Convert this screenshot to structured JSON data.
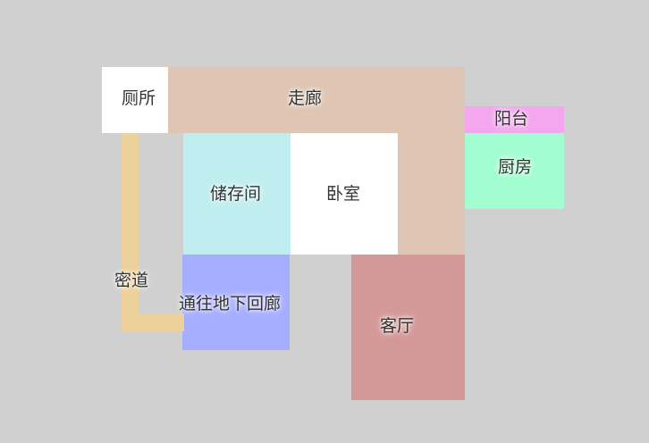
{
  "floorplan": {
    "rooms": {
      "toilet": {
        "label": "厕所",
        "color": "#ffffff"
      },
      "corridor": {
        "label": "走廊",
        "color": "#dfc5b3"
      },
      "balcony": {
        "label": "阳台",
        "color": "#f4a6ee"
      },
      "kitchen": {
        "label": "厨房",
        "color": "#a2fed0"
      },
      "storage": {
        "label": "储存间",
        "color": "#c0eef0"
      },
      "bedroom": {
        "label": "卧室",
        "color": "#ffffff"
      },
      "underground": {
        "label": "通往地下回廊",
        "color": "#a6aeff"
      },
      "living": {
        "label": "客厅",
        "color": "#d49898"
      }
    },
    "secret_passage": {
      "label": "密道",
      "color": "#edd19b"
    }
  }
}
